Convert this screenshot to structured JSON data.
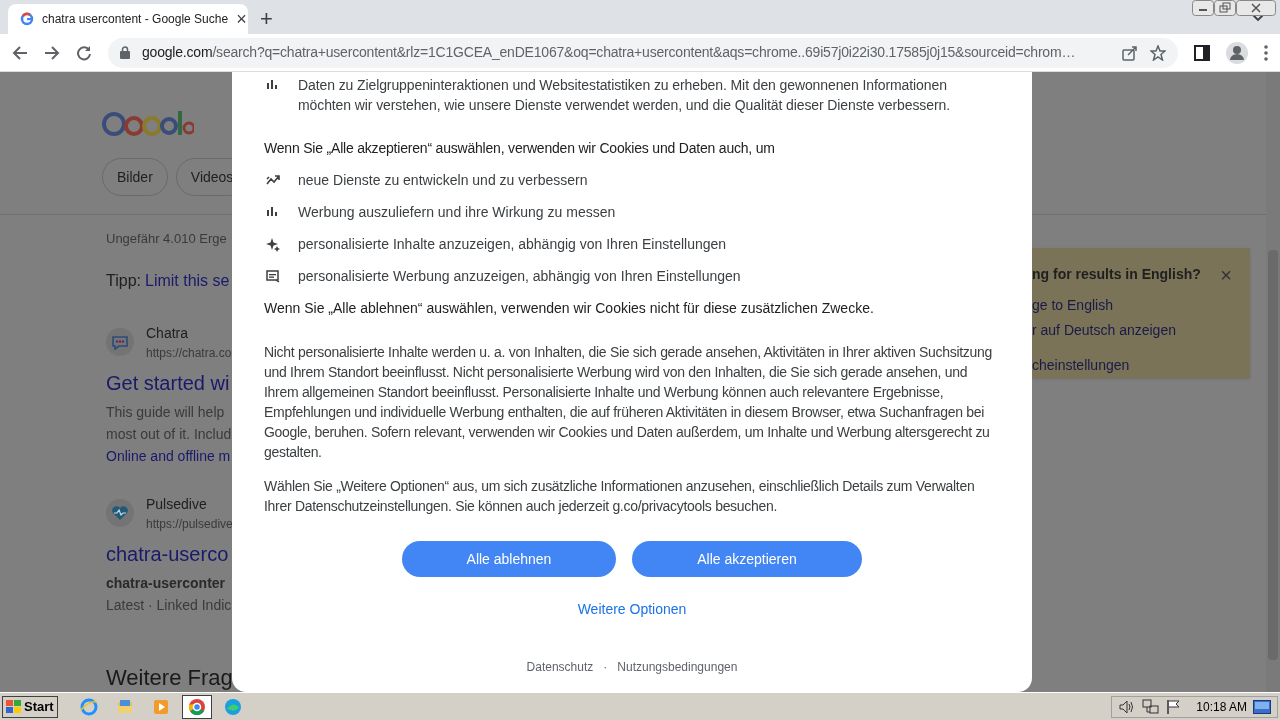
{
  "browser": {
    "tab": {
      "title": "chatra usercontent - Google Suche",
      "close": "×"
    },
    "new_tab": "+",
    "url_host": "google.com",
    "url_rest": "/search?q=chatra+usercontent&rlz=1C1GCEA_enDE1067&oq=chatra+usercontent&aqs=chrome..69i57j0i22i30.17585j0j15&sourceid=chrom…"
  },
  "page": {
    "filters": [
      {
        "label": "Bilder"
      },
      {
        "label": "Videos"
      }
    ],
    "result_count": "Ungefähr 4.010 Erge",
    "tip": {
      "label": "Tipp:",
      "link": "Limit this se"
    },
    "results": [
      {
        "site": "Chatra",
        "url": "https://chatra.co",
        "title": "Get started wi",
        "lines": [
          {
            "kind": "text",
            "text": "This guide will help"
          },
          {
            "kind": "text",
            "text": "most out of it. Includ"
          },
          {
            "kind": "link",
            "text": "Online and offline m"
          }
        ]
      },
      {
        "site": "Pulsedive",
        "url": "https://pulsedive",
        "title": "chatra-userco",
        "lines": [
          {
            "kind": "bold",
            "text": "chatra-userconter"
          },
          {
            "kind": "text",
            "text": "Latest · Linked Indic"
          }
        ]
      }
    ],
    "more_heading": "Weitere Frag",
    "language_card": {
      "title": "ng for results in English?",
      "close": "×",
      "links": [
        "ge to English",
        "r auf Deutsch anzeigen",
        "cheinstellungen"
      ]
    }
  },
  "dialog": {
    "lead_item": {
      "text": "Daten zu Zielgruppeninteraktionen und Websitestatistiken zu erheben. Mit den gewonnenen Informationen möchten wir verstehen, wie unsere Dienste verwendet werden, und die Qualität dieser Dienste verbessern."
    },
    "accept_heading": "Wenn Sie „Alle akzeptieren“ auswählen, verwenden wir Cookies und Daten auch, um",
    "accept_items": [
      {
        "text": "neue Dienste zu entwickeln und zu verbessern"
      },
      {
        "text": "Werbung auszuliefern und ihre Wirkung zu messen"
      },
      {
        "text": "personalisierte Inhalte anzuzeigen, abhängig von Ihren Einstellungen"
      },
      {
        "text": "personalisierte Werbung anzuzeigen, abhängig von Ihren Einstellungen"
      }
    ],
    "reject_note": "Wenn Sie „Alle ablehnen“ auswählen, verwenden wir Cookies nicht für diese zusätzlichen Zwecke.",
    "paragraphs": [
      "Nicht personalisierte Inhalte werden u. a. von Inhalten, die Sie sich gerade ansehen, Aktivitäten in Ihrer aktiven Suchsitzung und Ihrem Standort beeinflusst. Nicht personalisierte Werbung wird von den Inhalten, die Sie sich gerade ansehen, und Ihrem allgemeinen Standort beeinflusst. Personalisierte Inhalte und Werbung können auch relevantere Ergebnisse, Empfehlungen und individuelle Werbung enthalten, die auf früheren Aktivitäten in diesem Browser, etwa Suchanfragen bei Google, beruhen. Sofern relevant, verwenden wir Cookies und Daten außerdem, um Inhalte und Werbung altersgerecht zu gestalten.",
      "Wählen Sie „Weitere Optionen“ aus, um sich zusätzliche Informationen anzusehen, einschließlich Details zum Verwalten Ihrer Datenschutzeinstellungen. Sie können auch jederzeit g.co/privacytools besuchen."
    ],
    "buttons": [
      "Alle ablehnen",
      "Alle akzeptieren"
    ],
    "more_options": "Weitere Optionen",
    "footer_links": [
      "Datenschutz",
      "Nutzungsbedingungen"
    ],
    "footer_separator": "·"
  },
  "taskbar": {
    "start": "Start",
    "apps": [
      {
        "selected": false
      },
      {
        "selected": false
      },
      {
        "selected": false
      },
      {
        "selected": true
      },
      {
        "selected": false
      }
    ],
    "clock": "10:18 AM"
  }
}
